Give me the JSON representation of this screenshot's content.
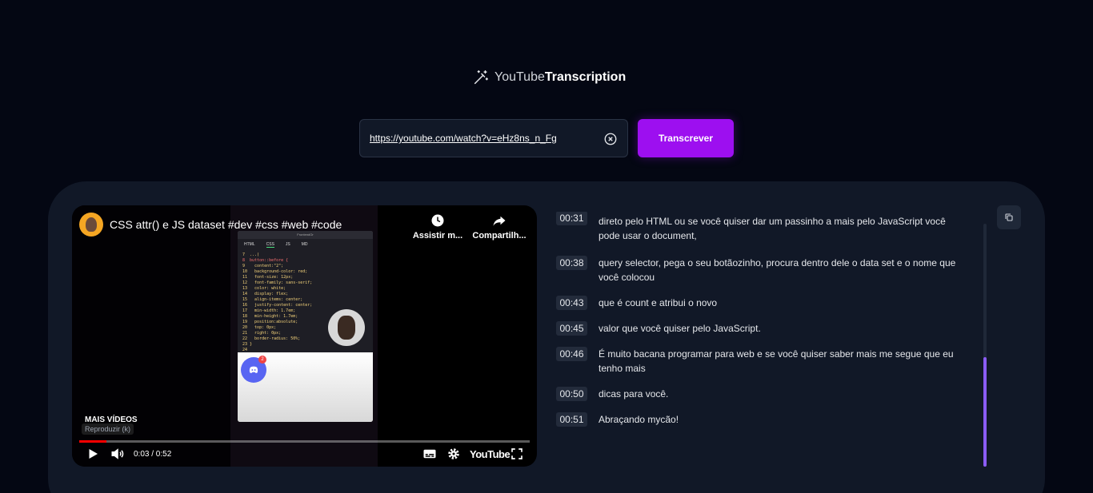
{
  "app": {
    "logo_prefix": "YouTube",
    "logo_bold": "Transcription",
    "icon": "magic-wand-icon"
  },
  "search": {
    "value": "https://youtube.com/watch?v=eHz8ns_n_Fg",
    "clear_icon": "circle-x-icon",
    "button_label": "Transcrever",
    "button_color": "#9d0ff0"
  },
  "player": {
    "title": "CSS attr() e JS dataset #dev #css #web #code",
    "watch_later_label": "Assistir m...",
    "share_label": "Compartilh...",
    "more_videos_label": "MAIS VÍDEOS",
    "play_hint": "Reproduzir (k)",
    "time": "0:03 / 0:52",
    "progress": 0.06,
    "youtube_logo": "YouTube",
    "code_window": {
      "title": "FrontendOr",
      "tabs": [
        "HTML",
        "CSS",
        "JS",
        "MD"
      ],
      "active_tab": "CSS",
      "lines": [
        "7  ...(",
        "8  button::before {",
        "9    content:\"2\";",
        "10   background-color: red;",
        "11   font-size: 12px;",
        "12   font-family: sans-serif;",
        "13   color: white;",
        "14   display: flex;",
        "15   align-items: center;",
        "16   justify-content: center;",
        "17   min-width: 1.7em;",
        "18   min-height: 1.7em;",
        "19   position:absolute;",
        "20   top: 0px;",
        "21   right: 0px;",
        "22   border-radius: 50%;",
        "23 }",
        "24"
      ],
      "discord_badge": "2"
    }
  },
  "transcript": [
    {
      "time": "00:31",
      "text": "direto pelo  HTML ou se  você quiser dar  um passinho a  mais pelo JavaScript  você pode usar  o document,"
    },
    {
      "time": "00:38",
      "text": "query selector,  pega o seu  botãozinho, procura dentro  dele o data  set e o  nome que você  colocou"
    },
    {
      "time": "00:43",
      "text": "que é  count e atribui  o novo"
    },
    {
      "time": "00:45",
      "text": "valor que  você quiser pelo  JavaScript."
    },
    {
      "time": "00:46",
      "text": "É muito  bacana programar para  web e se  você quiser saber  mais me segue  que eu tenho  mais"
    },
    {
      "time": "00:50",
      "text": "dicas para  você."
    },
    {
      "time": "00:51",
      "text": "Abraçando mycão!"
    }
  ],
  "scroll": {
    "position": 0.55,
    "visible_fraction": 0.45,
    "thumb_color": "#8b5cf6"
  },
  "copy_icon": "copy-icon"
}
